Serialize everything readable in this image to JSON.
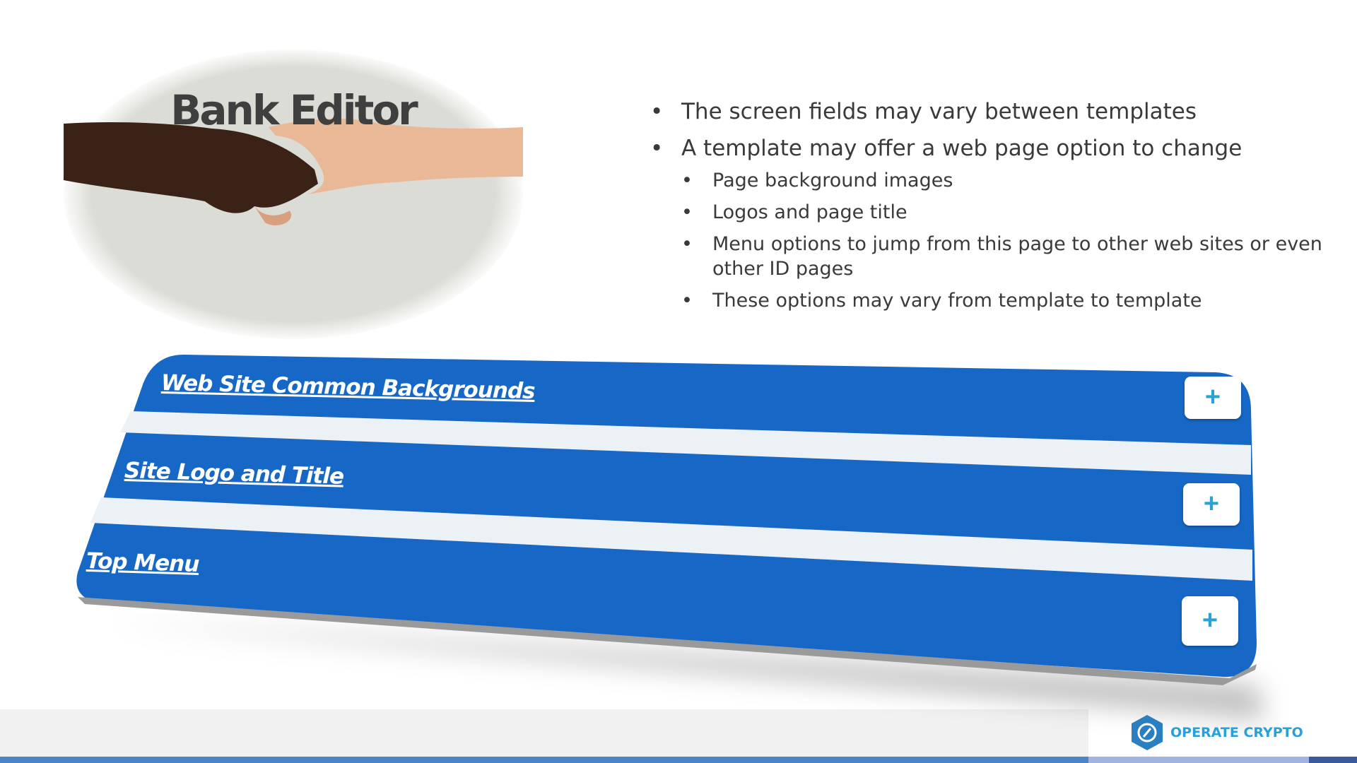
{
  "title": "Bank Editor",
  "bullets": [
    {
      "text": "The screen fields may vary between templates",
      "sub": []
    },
    {
      "text": "A template may offer a web page option to change",
      "sub": [
        "Page background images",
        "Logos and page title",
        "Menu options to jump from this page to other web sites or even other ID pages",
        "These options may vary from template to template"
      ]
    }
  ],
  "panel": {
    "sections": [
      {
        "label": "Web Site Common Backgrounds",
        "button": "+"
      },
      {
        "label": "Site Logo and Title",
        "button": "+"
      },
      {
        "label": "Top Menu",
        "button": "+"
      }
    ],
    "colors": {
      "bar": "#1767c6",
      "stripe": "#ebf1f4",
      "plus": "#29a3d6"
    }
  },
  "footer": {
    "brand": "OPERATE CRYPTO",
    "icon": "hexagon-logo-icon"
  }
}
